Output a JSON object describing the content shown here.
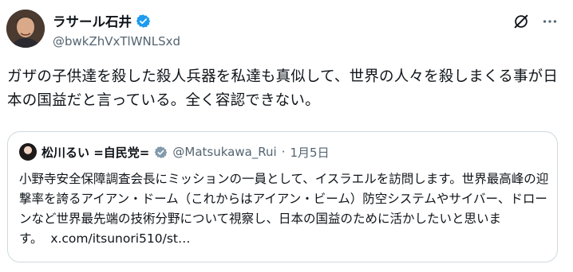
{
  "author": {
    "display_name": "ラサール石井",
    "handle": "@bwkZhVxTlWNLSxd"
  },
  "tweet": {
    "text": "ガザの子供達を殺した殺人兵器を私達も真似して、世界の人々を殺しまくる事が日本の国益だと言っている。全く容認できない。"
  },
  "quoted": {
    "display_name": "松川るい =自民党=",
    "handle": "@Matsukawa_Rui",
    "separator": "·",
    "date": "1月5日",
    "text": "小野寺安全保障調査会長にミッションの一員として、イスラエルを訪問します。世界最高峰の迎撃率を誇るアイアン・ドーム（これからはアイアン・ビーム）防空システムやサイバー、ドローンなど世界最先端の技術分野について視察し、日本の国益のために活かしたいと思います。",
    "link": "x.com/itsunori510/st…"
  },
  "icons": {
    "verified": "verified-badge-icon",
    "grok": "grok-icon",
    "more": "more-options-icon"
  },
  "colors": {
    "verified_blue": "#1d9bf0",
    "verified_gray": "#829aab",
    "secondary_text": "#536471",
    "border": "#cfd9de"
  }
}
